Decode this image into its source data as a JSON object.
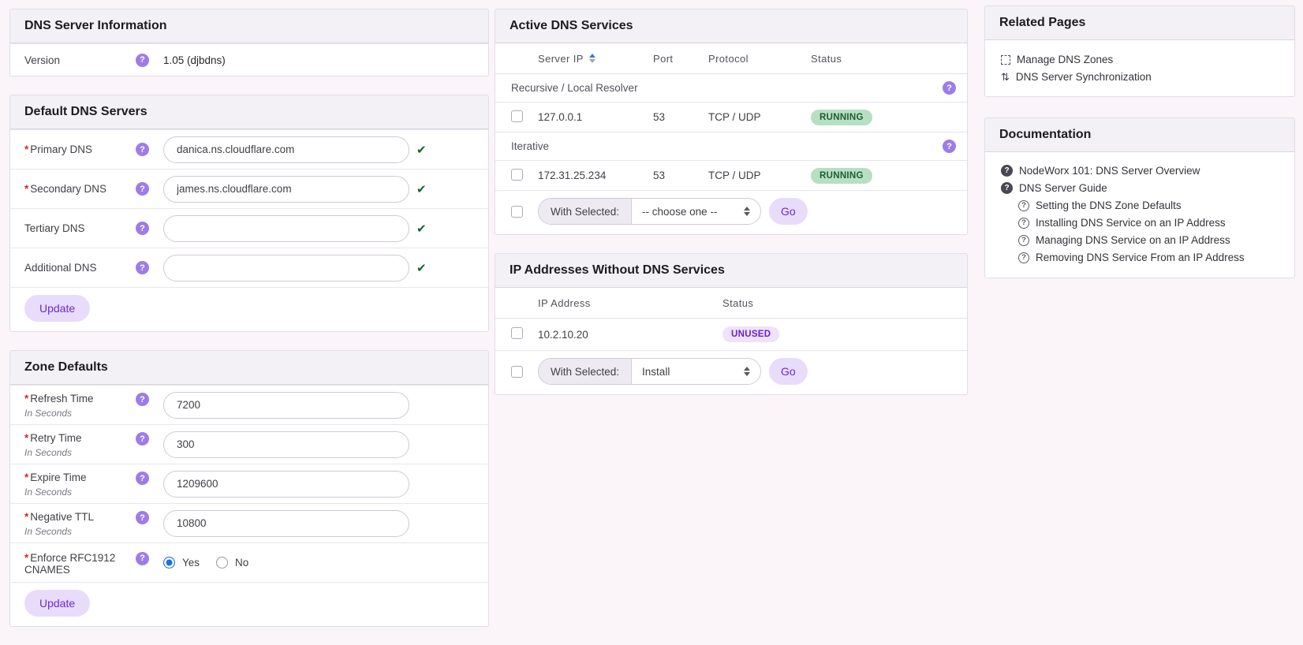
{
  "colors": {
    "page_background": "#fbf4f9",
    "card_header_background": "#f4f1f6",
    "accent_purple": "#6d28d9",
    "help_icon_purple": "#9d7cea",
    "button_purple_bg": "#e9dcfa",
    "running_badge_bg": "#b7dfc2",
    "running_badge_text": "#1c5e31",
    "unused_badge_bg": "#efe2fc",
    "unused_badge_text": "#6b21c8",
    "valid_check_green": "#15642e",
    "radio_selected_blue": "#1a6fe0",
    "sort_asc_blue": "#3379e6"
  },
  "icons": {
    "question": "?",
    "check": "✔",
    "sync": "⇅"
  },
  "dns_server_information": {
    "title": "DNS Server Information",
    "version_label": "Version",
    "version_value": "1.05 (djbdns)"
  },
  "default_dns_servers": {
    "title": "Default DNS Servers",
    "fields": [
      {
        "label": "Primary DNS",
        "required": "*",
        "value": "danica.ns.cloudflare.com"
      },
      {
        "label": "Secondary DNS",
        "required": "*",
        "value": "james.ns.cloudflare.com"
      },
      {
        "label": "Tertiary DNS",
        "value": ""
      },
      {
        "label": "Additional DNS",
        "value": ""
      }
    ],
    "update_label": "Update"
  },
  "zone_defaults": {
    "title": "Zone Defaults",
    "fields": [
      {
        "label": "Refresh Time",
        "required": "*",
        "sublabel": "In Seconds",
        "value": "7200"
      },
      {
        "label": "Retry Time",
        "required": "*",
        "sublabel": "In Seconds",
        "value": "300"
      },
      {
        "label": "Expire Time",
        "required": "*",
        "sublabel": "In Seconds",
        "value": "1209600"
      },
      {
        "label": "Negative TTL",
        "required": "*",
        "sublabel": "In Seconds",
        "value": "10800"
      }
    ],
    "rfc_field": {
      "label": "Enforce RFC1912 CNAMES",
      "required": "*",
      "yes_label": "Yes",
      "no_label": "No"
    },
    "update_label": "Update"
  },
  "active_dns_services": {
    "title": "Active DNS Services",
    "columns": {
      "server_ip": "Server IP",
      "port": "Port",
      "protocol": "Protocol",
      "status": "Status"
    },
    "sections": [
      {
        "label": "Recursive / Local Resolver",
        "rows": [
          {
            "ip": "127.0.0.1",
            "port": "53",
            "protocol": "TCP / UDP",
            "status": "RUNNING"
          }
        ]
      },
      {
        "label": "Iterative",
        "rows": [
          {
            "ip": "172.31.25.234",
            "port": "53",
            "protocol": "TCP / UDP",
            "status": "RUNNING"
          }
        ]
      }
    ],
    "with_selected_label": "With Selected:",
    "with_selected_value": "-- choose one --",
    "go_label": "Go"
  },
  "ip_without_dns": {
    "title": "IP Addresses Without DNS Services",
    "columns": {
      "ip": "IP Address",
      "status": "Status"
    },
    "rows": [
      {
        "ip": "10.2.10.20",
        "status": "UNUSED"
      }
    ],
    "with_selected_label": "With Selected:",
    "with_selected_value": "Install",
    "go_label": "Go"
  },
  "related_pages": {
    "title": "Related Pages",
    "items": [
      {
        "label": "Manage DNS Zones"
      },
      {
        "label": "DNS Server Synchronization"
      }
    ]
  },
  "documentation": {
    "title": "Documentation",
    "items": [
      {
        "label": "NodeWorx 101: DNS Server Overview"
      },
      {
        "label": "DNS Server Guide"
      }
    ],
    "subitems": [
      {
        "label": "Setting the DNS Zone Defaults"
      },
      {
        "label": "Installing DNS Service on an IP Address"
      },
      {
        "label": "Managing DNS Service on an IP Address"
      },
      {
        "label": "Removing DNS Service From an IP Address"
      }
    ]
  }
}
